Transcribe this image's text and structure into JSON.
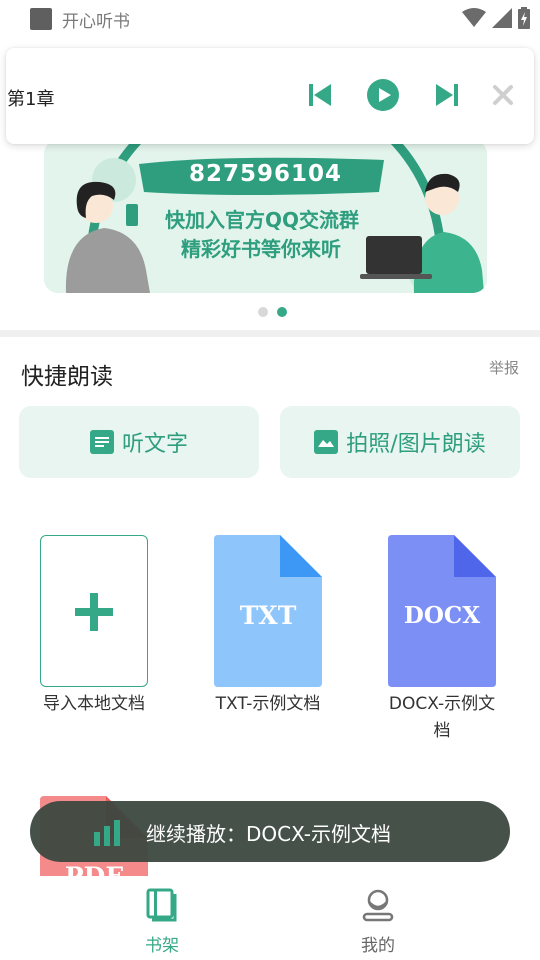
{
  "status_bar": {
    "app_name": "开心听书",
    "icons": [
      "wifi-icon",
      "signal-icon",
      "battery-charging-icon"
    ]
  },
  "player": {
    "chapter": "第1章",
    "controls": [
      "skip-previous-icon",
      "play-icon",
      "skip-next-icon",
      "close-icon"
    ]
  },
  "banner": {
    "qq_number": "827596104",
    "line1": "快加入官方QQ交流群",
    "line2": "精彩好书等你来听",
    "page_count": 2,
    "active_page": 2
  },
  "quick_read": {
    "title": "快捷朗读",
    "report": "举报",
    "listen_text": "听文字",
    "photo_read": "拍照/图片朗读"
  },
  "documents": {
    "import_label": "导入本地文档",
    "txt": {
      "badge": "TXT",
      "label": "TXT-示例文档"
    },
    "docx": {
      "badge": "DOCX",
      "label_line1": "DOCX-示例文",
      "label_line2": "档"
    },
    "pdf": {
      "badge": "PDF"
    }
  },
  "toast": {
    "text": "继续播放：DOCX-示例文档"
  },
  "bottom_nav": {
    "bookshelf": "书架",
    "mine": "我的"
  },
  "colors": {
    "accent": "#35a987",
    "accent_light": "#e9f5f1",
    "txt_file": "#8ec5fb",
    "txt_fold": "#3d98f5",
    "docx_file": "#7c8ff5",
    "docx_fold": "#4f65ea",
    "pdf_file": "#f58a8a",
    "toast_bg": "#3c4840"
  }
}
